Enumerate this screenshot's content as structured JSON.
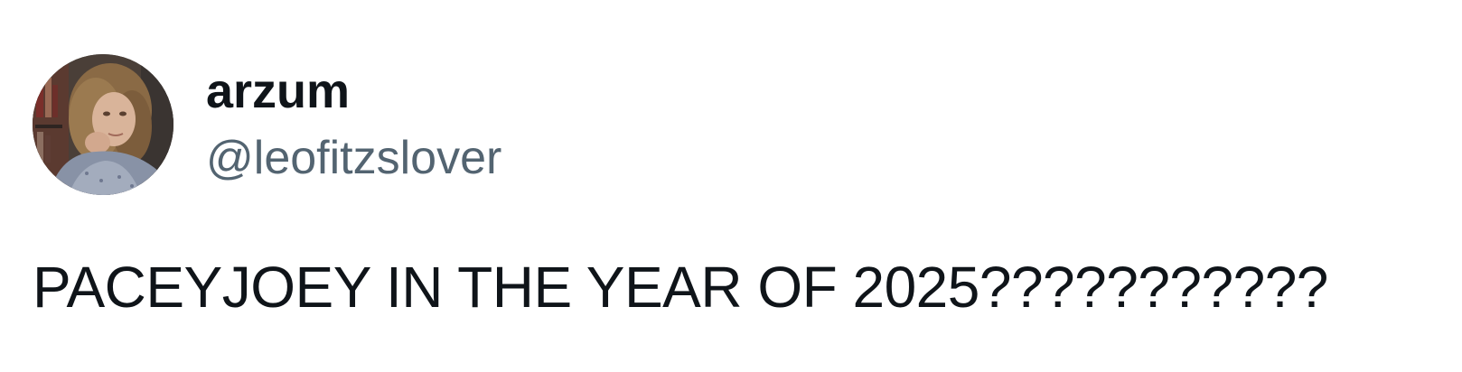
{
  "author": {
    "display_name": "arzum",
    "handle": "@leofitzslover",
    "avatar_icon": "user-avatar-photo"
  },
  "tweet": {
    "text": "PACEYJOEY IN THE YEAR OF 2025???????????"
  },
  "colors": {
    "name": "#0f1419",
    "handle": "#536471",
    "text": "#0f1419",
    "background": "#ffffff"
  }
}
